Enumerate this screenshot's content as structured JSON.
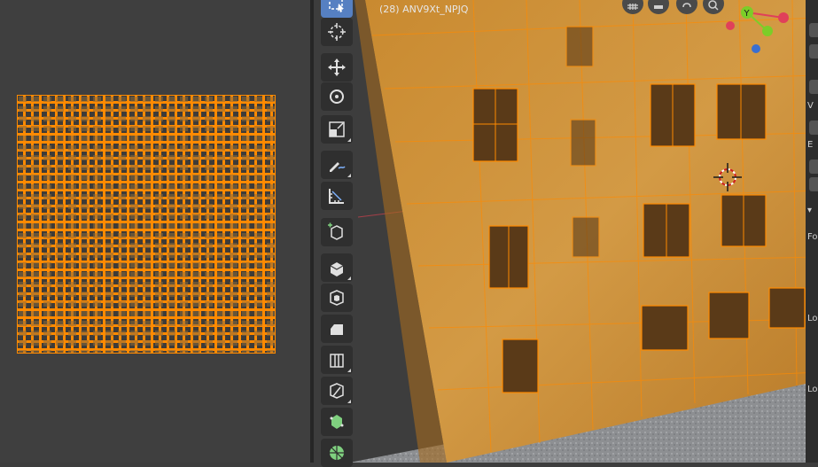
{
  "viewport": {
    "object_label": "(28) ANV9Xt_NPJQ"
  },
  "toolbar": {
    "tools": [
      {
        "name": "select-box-tool",
        "active": true
      },
      {
        "name": "cursor-tool",
        "active": false
      },
      {
        "name": "move-tool",
        "active": false
      },
      {
        "name": "rotate-tool",
        "active": false
      },
      {
        "name": "scale-tool",
        "active": false
      },
      {
        "name": "annotate-tool",
        "active": false
      },
      {
        "name": "measure-tool",
        "active": false
      },
      {
        "name": "add-cube-tool",
        "active": false
      },
      {
        "name": "extrude-tool",
        "active": false
      },
      {
        "name": "inset-tool",
        "active": false
      },
      {
        "name": "bevel-tool",
        "active": false
      },
      {
        "name": "loop-cut-tool",
        "active": false
      },
      {
        "name": "knife-tool",
        "active": false
      },
      {
        "name": "poly-build-tool",
        "active": false
      },
      {
        "name": "spin-tool",
        "active": false
      }
    ]
  },
  "navigation": {
    "gizmo_axis_label": "Y",
    "buttons": [
      "grid-icon",
      "camera-icon",
      "hand-icon",
      "zoom-icon"
    ]
  },
  "properties_panel": {
    "letters": [
      "V",
      "E",
      "Fo",
      "Lo",
      "Lo"
    ]
  },
  "colors": {
    "selection_orange": "#ff8a00",
    "wall_tint": "#d08f2e",
    "active_tool": "#5680c2",
    "axis_x": "#e0405a",
    "axis_y": "#7ccd28",
    "axis_z": "#3b6fd0"
  }
}
